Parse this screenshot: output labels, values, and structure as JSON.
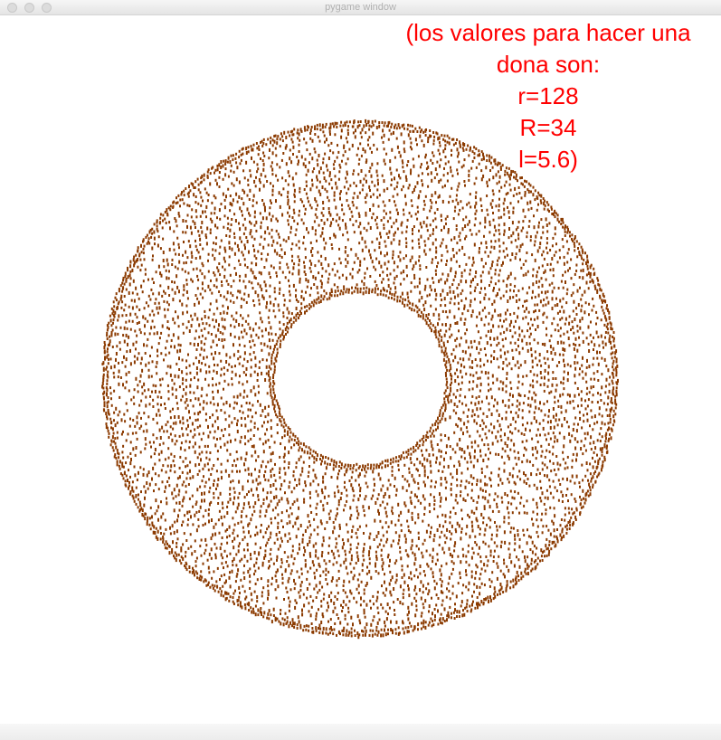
{
  "window": {
    "title": "pygame window"
  },
  "caption_lines": [
    "(los valores para hacer una",
    "dona son:",
    "r=128",
    "R=34",
    "l=5.6)"
  ],
  "colors": {
    "caption": "#ff0000",
    "dots": "#8b3a00",
    "background": "#ffffff"
  }
}
